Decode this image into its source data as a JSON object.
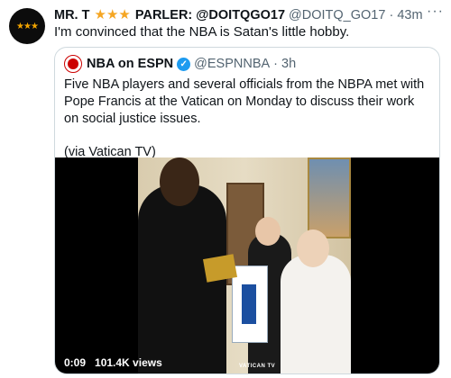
{
  "tweet": {
    "avatar_text": "★★★",
    "author_name": "MR. T",
    "author_stars": "★★★",
    "author_suffix": "PARLER: @DOITQGO17",
    "handle": "@DOITQ_GO17",
    "separator": "·",
    "time": "43m",
    "more_icon": "···",
    "text": "I'm convinced that the NBA is Satan's little hobby."
  },
  "quote": {
    "name": "NBA on ESPN",
    "verified_icon": "✓",
    "handle": "@ESPNNBA",
    "separator": "·",
    "time": "3h",
    "text": "Five NBA players and several officials from the NBPA met with Pope Francis at the Vatican on Monday to discuss their work on social justice issues.",
    "credit": "(via Vatican TV)",
    "video": {
      "time": "0:09",
      "views": "101.4K views",
      "watermark": "VATICAN TV"
    }
  }
}
